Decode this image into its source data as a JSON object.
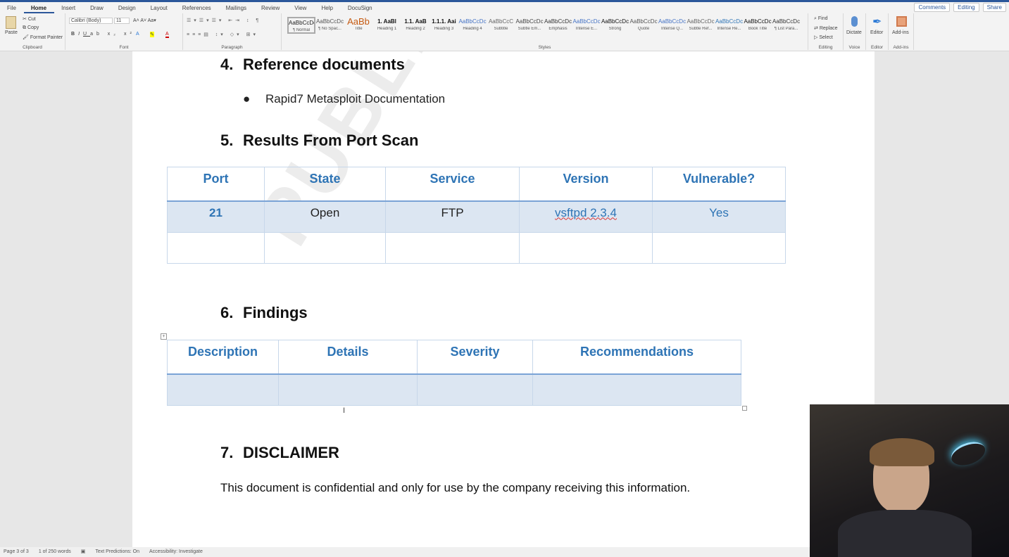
{
  "ribbon": {
    "tabs": [
      "File",
      "Home",
      "Insert",
      "Draw",
      "Design",
      "Layout",
      "References",
      "Mailings",
      "Review",
      "View",
      "Help",
      "DocuSign"
    ],
    "top_buttons": {
      "comments": "Comments",
      "editing": "Editing",
      "share": "Share"
    },
    "clipboard": {
      "paste": "Paste",
      "cut": "Cut",
      "copy": "Copy",
      "format_painter": "Format Painter",
      "label": "Clipboard"
    },
    "font": {
      "name": "Calibri (Body)",
      "size": "11",
      "label": "Font"
    },
    "paragraph": {
      "label": "Paragraph"
    },
    "styles": {
      "label": "Styles",
      "items": [
        {
          "preview": "AaBbCcDc",
          "name": "¶ Normal"
        },
        {
          "preview": "AaBbCcDc",
          "name": "¶ No Spac..."
        },
        {
          "preview": "AaBb",
          "name": "Title"
        },
        {
          "preview": "1. AaBl",
          "name": "Heading 1"
        },
        {
          "preview": "1.1. AaB",
          "name": "Heading 2"
        },
        {
          "preview": "1.1.1. Aai",
          "name": "Heading 3"
        },
        {
          "preview": "AaBbCcDc",
          "name": "Heading 4"
        },
        {
          "preview": "AaBbCcC",
          "name": "Subtitle"
        },
        {
          "preview": "AaBbCcDc",
          "name": "Subtle Em..."
        },
        {
          "preview": "AaBbCcDc",
          "name": "Emphasis"
        },
        {
          "preview": "AaBbCcDc",
          "name": "Intense E..."
        },
        {
          "preview": "AaBbCcDc",
          "name": "Strong"
        },
        {
          "preview": "AaBbCcDc",
          "name": "Quote"
        },
        {
          "preview": "AaBbCcDc",
          "name": "Intense Q..."
        },
        {
          "preview": "AaBbCcDc",
          "name": "Subtle Ref..."
        },
        {
          "preview": "AaBbCcDc",
          "name": "Intense Re..."
        },
        {
          "preview": "AaBbCcDc",
          "name": "Book Title"
        },
        {
          "preview": "AaBbCcDc",
          "name": "¶ List Para..."
        }
      ]
    },
    "editing": {
      "find": "Find",
      "replace": "Replace",
      "select": "Select",
      "label": "Editing"
    },
    "voice": {
      "dictate": "Dictate",
      "label": "Voice"
    },
    "editor": {
      "editor": "Editor",
      "label": "Editor"
    },
    "addins": {
      "addins": "Add-ins",
      "label": "Add-ins"
    }
  },
  "document": {
    "watermark": "PUBLIC TEMPLATE",
    "sec4": {
      "num": "4.",
      "title": "Reference documents",
      "bullet": "Rapid7 Metasploit Documentation"
    },
    "sec5": {
      "num": "5.",
      "title": "Results From Port Scan",
      "headers": [
        "Port",
        "State",
        "Service",
        "Version",
        "Vulnerable?"
      ],
      "row": [
        "21",
        "Open",
        "FTP",
        "vsftpd 2.3.4",
        "Yes"
      ]
    },
    "sec6": {
      "num": "6.",
      "title": "Findings",
      "headers": [
        "Description",
        "Details",
        "Severity",
        "Recommendations"
      ]
    },
    "sec7": {
      "num": "7.",
      "title": "DISCLAIMER",
      "text": "This document is confidential and only for use by the company receiving this information."
    }
  },
  "status": {
    "page": "Page 3 of 3",
    "words": "1 of 250 words",
    "predictions": "Text Predictions: On",
    "accessibility": "Accessibility: Investigate"
  }
}
